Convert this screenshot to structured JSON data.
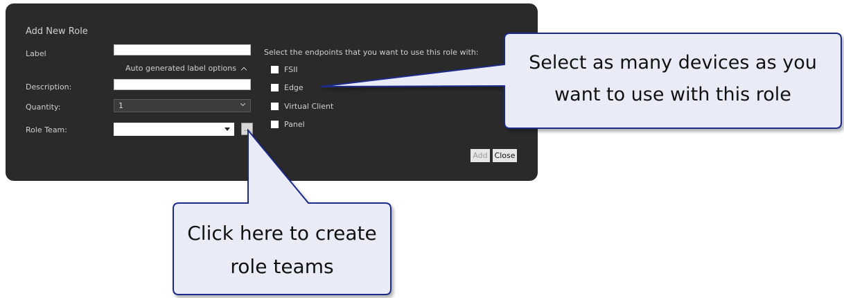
{
  "dialog": {
    "title": "Add New Role",
    "label_label": "Label",
    "label_value": "",
    "autogen_label": "Auto generated label options",
    "description_label": "Description:",
    "description_value": "",
    "quantity_label": "Quantity:",
    "quantity_value": "1",
    "role_team_label": "Role Team:",
    "role_team_value": "",
    "role_team_button": "...",
    "endpoints_prompt": "Select the endpoints that you want to use this role with:",
    "endpoints": [
      {
        "label": "FSII",
        "checked": false
      },
      {
        "label": "Edge",
        "checked": false
      },
      {
        "label": "Virtual Client",
        "checked": false
      },
      {
        "label": "Panel",
        "checked": false
      }
    ],
    "add_button": "Add",
    "close_button": "Close"
  },
  "callouts": {
    "devices_line1": "Select as many devices as you",
    "devices_line2": "want to use with this role",
    "teams_line1": "Click here to create",
    "teams_line2": "role teams"
  },
  "colors": {
    "dialog_bg": "#2a2a2a",
    "callout_fill": "#e9ecf6",
    "callout_border": "#1f2a8a"
  },
  "icons": [
    "chevron-up-icon",
    "chevron-down-icon",
    "dropdown-arrow-icon"
  ]
}
